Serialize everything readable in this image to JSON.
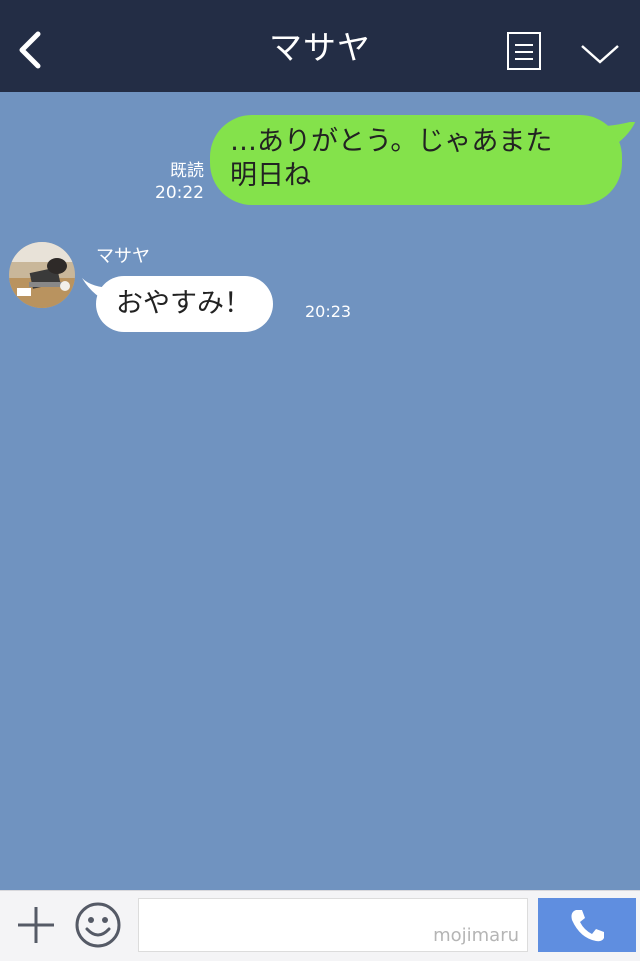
{
  "header": {
    "title": "マサヤ",
    "back_icon": "chevron-left-icon",
    "menu_icon": "note-icon",
    "expand_icon": "chevron-down-icon"
  },
  "messages": {
    "outgoing": {
      "text_line1": "…ありがとう。じゃあまた",
      "text_line2": "明日ね",
      "read_label": "既読",
      "time": "20:22",
      "bubble_color": "#84e24b"
    },
    "incoming": {
      "sender": "マサヤ",
      "text": "おやすみ！",
      "time": "20:23",
      "bubble_color": "#ffffff"
    }
  },
  "composer": {
    "plus_icon": "plus-icon",
    "sticker_icon": "smile-icon",
    "input_value": "",
    "watermark": "mojimaru",
    "call_icon": "phone-icon",
    "call_color": "#5f8ee0"
  },
  "colors": {
    "header": "#232d45",
    "chat_background": "#7093c0"
  }
}
